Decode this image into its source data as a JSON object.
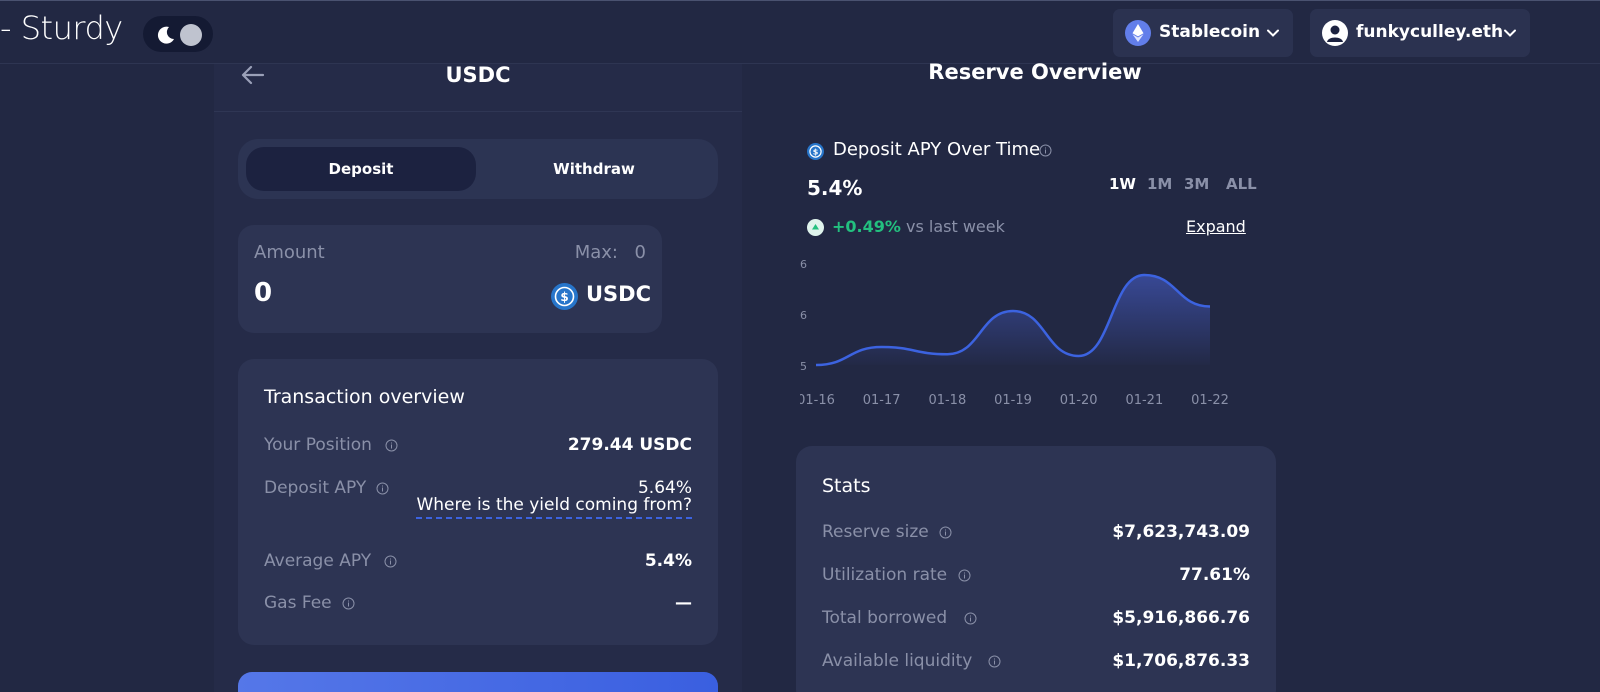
{
  "header": {
    "logo_text": "- Sturdy",
    "network": {
      "label": "Stablecoin",
      "icon": "ethereum-icon"
    },
    "account": {
      "label": "funkyculley.eth",
      "icon": "user-icon"
    }
  },
  "asset_panel": {
    "title": "USDC",
    "tabs": [
      {
        "label": "Deposit",
        "active": true
      },
      {
        "label": "Withdraw",
        "active": false
      }
    ],
    "amount": {
      "label": "Amount",
      "max_label": "Max:",
      "max_value": "0",
      "value": "0",
      "token": "USDC"
    },
    "transaction_overview": {
      "title": "Transaction overview",
      "rows": [
        {
          "label": "Your Position",
          "value": "279.44 USDC"
        },
        {
          "label": "Deposit APY",
          "value": "5.64%",
          "link": "Where is the yield coming from?"
        },
        {
          "label": "Average APY",
          "value": "5.4%"
        },
        {
          "label": "Gas Fee",
          "value": "—"
        }
      ]
    }
  },
  "reserve_overview": {
    "title": "Reserve Overview",
    "chart_header": {
      "title": "Deposit APY Over Time",
      "current_value": "5.4%",
      "ranges": [
        "1W",
        "1M",
        "3M",
        "ALL"
      ],
      "active_range": "1W",
      "change": "+0.49%",
      "change_suffix": "vs last week",
      "expand_label": "Expand"
    },
    "stats": {
      "title": "Stats",
      "rows": [
        {
          "label": "Reserve size",
          "value": "$7,623,743.09"
        },
        {
          "label": "Utilization rate",
          "value": "77.61%"
        },
        {
          "label": "Total borrowed",
          "value": "$5,916,866.76"
        },
        {
          "label": "Available liquidity",
          "value": "$1,706,876.33"
        }
      ]
    }
  },
  "colors": {
    "background": "#222843",
    "card": "#2d3453",
    "accent": "#3c63e0",
    "positive": "#23c07f",
    "muted": "#8a90a8"
  },
  "chart_data": {
    "type": "area",
    "x": [
      "01-16",
      "01-17",
      "01-18",
      "01-19",
      "01-20",
      "01-21",
      "01-22"
    ],
    "y_tick_labels": [
      "6",
      "6",
      "5"
    ],
    "ylim": [
      5.0,
      6.0
    ],
    "series": [
      {
        "values": [
          5.0,
          5.2,
          5.12,
          5.6,
          5.1,
          6.0,
          5.65
        ]
      }
    ],
    "xlabel": "",
    "ylabel": "",
    "grid": false
  }
}
